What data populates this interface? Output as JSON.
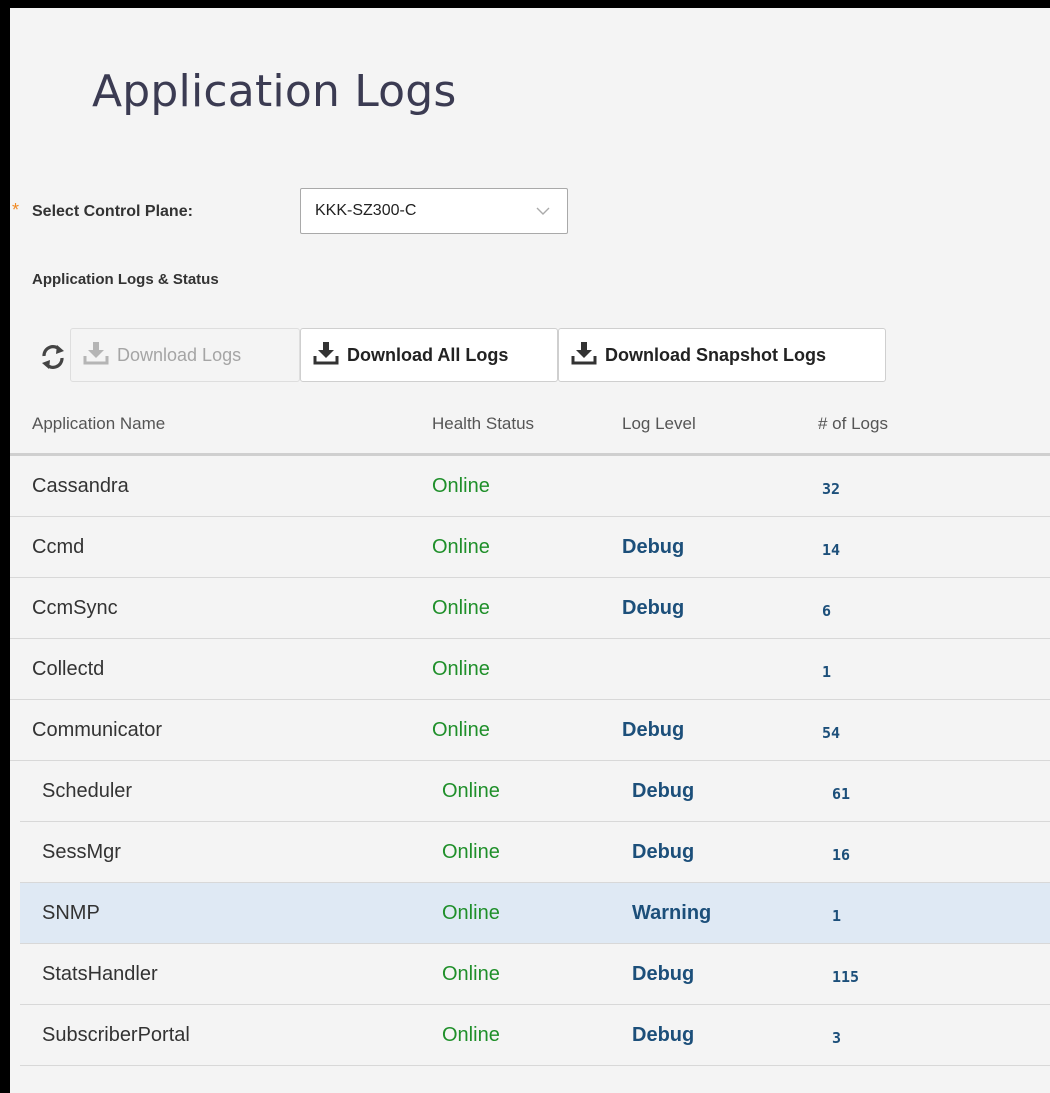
{
  "page": {
    "title": "Application Logs",
    "section_title": "Application Logs & Status"
  },
  "control_plane": {
    "required_marker": "*",
    "label": "Select Control Plane:",
    "selected": "KKK-SZ300-C"
  },
  "toolbar": {
    "refresh_icon": "refresh-icon",
    "download_logs": "Download Logs",
    "download_all_logs": "Download All Logs",
    "download_snapshot_logs": "Download Snapshot Logs",
    "download_logs_disabled": true
  },
  "table": {
    "columns": [
      "Application Name",
      "Health Status",
      "Log Level",
      "# of Logs"
    ],
    "rows": [
      {
        "name": "Cassandra",
        "health": "Online",
        "level": "",
        "count": "32"
      },
      {
        "name": "Ccmd",
        "health": "Online",
        "level": "Debug",
        "count": "14"
      },
      {
        "name": "CcmSync",
        "health": "Online",
        "level": "Debug",
        "count": "6"
      },
      {
        "name": "Collectd",
        "health": "Online",
        "level": "",
        "count": "1"
      },
      {
        "name": "Communicator",
        "health": "Online",
        "level": "Debug",
        "count": "54"
      },
      {
        "name": "Scheduler",
        "health": "Online",
        "level": "Debug",
        "count": "61"
      },
      {
        "name": "SessMgr",
        "health": "Online",
        "level": "Debug",
        "count": "16"
      },
      {
        "name": "SNMP",
        "health": "Online",
        "level": "Warning",
        "count": "1",
        "selected": true
      },
      {
        "name": "StatsHandler",
        "health": "Online",
        "level": "Debug",
        "count": "115"
      },
      {
        "name": "SubscriberPortal",
        "health": "Online",
        "level": "Debug",
        "count": "3"
      }
    ]
  },
  "colors": {
    "online": "#1f8f2a",
    "level": "#1c4f7a",
    "selected_row": "#dfe9f4",
    "required": "#f08a24"
  }
}
